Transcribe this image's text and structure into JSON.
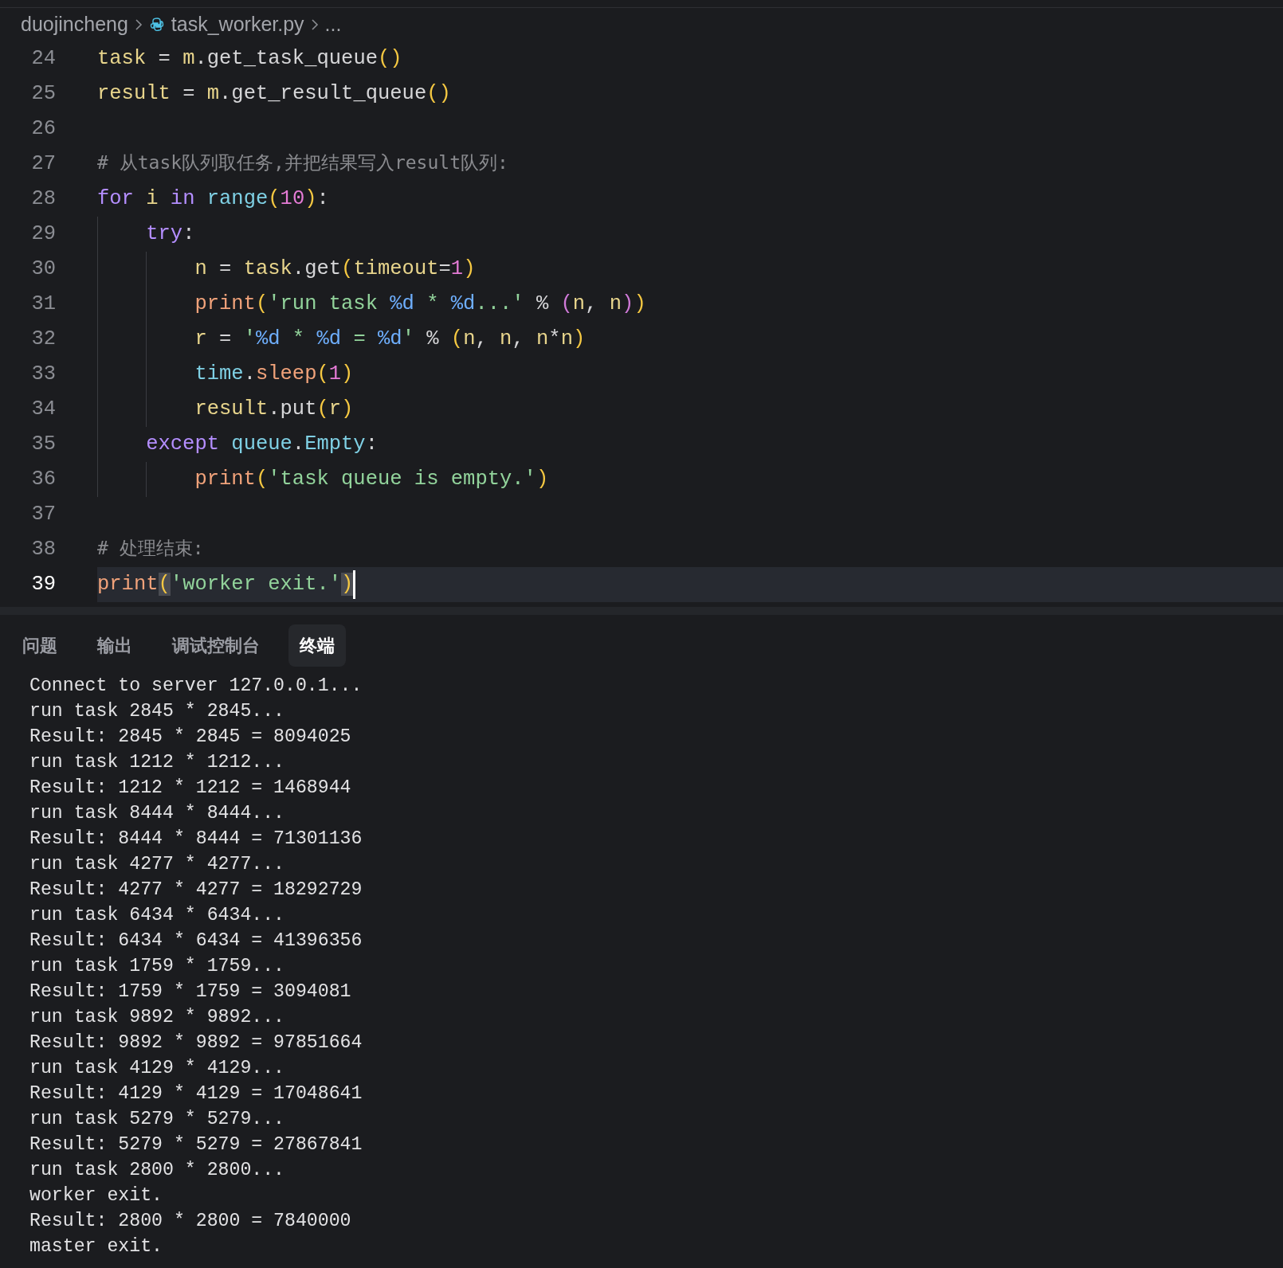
{
  "breadcrumb": [
    {
      "label": "duojincheng",
      "kind": "folder"
    },
    {
      "label": "task_worker.py",
      "kind": "file"
    },
    {
      "label": "...",
      "kind": "more"
    }
  ],
  "editor": {
    "lines": [
      {
        "number": "24",
        "current": false,
        "tokens": [
          {
            "kind": "var",
            "text": "task"
          },
          {
            "kind": "plain",
            "text": " = "
          },
          {
            "kind": "var",
            "text": "m"
          },
          {
            "kind": "plain",
            "text": ".get_task_queue"
          },
          {
            "kind": "paren",
            "text": "()"
          }
        ]
      },
      {
        "number": "25",
        "current": false,
        "tokens": [
          {
            "kind": "var",
            "text": "result"
          },
          {
            "kind": "plain",
            "text": " = "
          },
          {
            "kind": "var",
            "text": "m"
          },
          {
            "kind": "plain",
            "text": ".get_result_queue"
          },
          {
            "kind": "paren",
            "text": "()"
          }
        ]
      },
      {
        "number": "26",
        "current": false
      },
      {
        "number": "27",
        "current": false,
        "tokens": [
          {
            "kind": "comment",
            "text": "# 从task队列取任务,并把结果写入result队列:"
          }
        ]
      },
      {
        "number": "28",
        "current": false,
        "tokens": [
          {
            "kind": "keyword",
            "text": "for "
          },
          {
            "kind": "var",
            "text": "i "
          },
          {
            "kind": "keyword",
            "text": "in "
          },
          {
            "kind": "builtin",
            "text": "range"
          },
          {
            "kind": "paren",
            "text": "("
          },
          {
            "kind": "number",
            "text": "10"
          },
          {
            "kind": "paren",
            "text": ")"
          },
          {
            "kind": "plain",
            "text": ":"
          }
        ],
        "children": [
          {
            "number": "29",
            "current": false,
            "tokens": [
              {
                "kind": "keyword",
                "text": "try"
              },
              {
                "kind": "plain",
                "text": ":"
              }
            ],
            "children": [
              {
                "number": "30",
                "current": false,
                "tokens": [
                  {
                    "kind": "var",
                    "text": "n"
                  },
                  {
                    "kind": "plain",
                    "text": " = "
                  },
                  {
                    "kind": "var",
                    "text": "task"
                  },
                  {
                    "kind": "plain",
                    "text": ".get"
                  },
                  {
                    "kind": "paren",
                    "text": "("
                  },
                  {
                    "kind": "var",
                    "text": "timeout"
                  },
                  {
                    "kind": "plain",
                    "text": "="
                  },
                  {
                    "kind": "number",
                    "text": "1"
                  },
                  {
                    "kind": "paren",
                    "text": ")"
                  }
                ]
              },
              {
                "number": "31",
                "current": false,
                "tokens": [
                  {
                    "kind": "function",
                    "text": "print"
                  },
                  {
                    "kind": "paren",
                    "text": "("
                  },
                  {
                    "kind": "string",
                    "text": "'run task "
                  },
                  {
                    "kind": "format",
                    "text": "%d"
                  },
                  {
                    "kind": "string",
                    "text": " * "
                  },
                  {
                    "kind": "format",
                    "text": "%d"
                  },
                  {
                    "kind": "string",
                    "text": "...'"
                  },
                  {
                    "kind": "plain",
                    "text": " % "
                  },
                  {
                    "kind": "paren2",
                    "text": "("
                  },
                  {
                    "kind": "var",
                    "text": "n"
                  },
                  {
                    "kind": "plain",
                    "text": ", "
                  },
                  {
                    "kind": "var",
                    "text": "n"
                  },
                  {
                    "kind": "paren2",
                    "text": ")"
                  },
                  {
                    "kind": "paren",
                    "text": ")"
                  }
                ]
              },
              {
                "number": "32",
                "current": false,
                "tokens": [
                  {
                    "kind": "var",
                    "text": "r"
                  },
                  {
                    "kind": "plain",
                    "text": " = "
                  },
                  {
                    "kind": "string",
                    "text": "'"
                  },
                  {
                    "kind": "format",
                    "text": "%d"
                  },
                  {
                    "kind": "string",
                    "text": " * "
                  },
                  {
                    "kind": "format",
                    "text": "%d"
                  },
                  {
                    "kind": "string",
                    "text": " = "
                  },
                  {
                    "kind": "format",
                    "text": "%d"
                  },
                  {
                    "kind": "string",
                    "text": "'"
                  },
                  {
                    "kind": "plain",
                    "text": " % "
                  },
                  {
                    "kind": "paren",
                    "text": "("
                  },
                  {
                    "kind": "var",
                    "text": "n"
                  },
                  {
                    "kind": "plain",
                    "text": ", "
                  },
                  {
                    "kind": "var",
                    "text": "n"
                  },
                  {
                    "kind": "plain",
                    "text": ", "
                  },
                  {
                    "kind": "var",
                    "text": "n"
                  },
                  {
                    "kind": "plain",
                    "text": "*"
                  },
                  {
                    "kind": "var",
                    "text": "n"
                  },
                  {
                    "kind": "paren",
                    "text": ")"
                  }
                ]
              },
              {
                "number": "33",
                "current": false,
                "tokens": [
                  {
                    "kind": "builtin",
                    "text": "time"
                  },
                  {
                    "kind": "plain",
                    "text": "."
                  },
                  {
                    "kind": "function",
                    "text": "sleep"
                  },
                  {
                    "kind": "paren",
                    "text": "("
                  },
                  {
                    "kind": "number",
                    "text": "1"
                  },
                  {
                    "kind": "paren",
                    "text": ")"
                  }
                ]
              },
              {
                "number": "34",
                "current": false,
                "tokens": [
                  {
                    "kind": "var",
                    "text": "result"
                  },
                  {
                    "kind": "plain",
                    "text": ".put"
                  },
                  {
                    "kind": "paren",
                    "text": "("
                  },
                  {
                    "kind": "var",
                    "text": "r"
                  },
                  {
                    "kind": "paren",
                    "text": ")"
                  }
                ]
              }
            ]
          },
          {
            "number": "35",
            "current": false,
            "tokens": [
              {
                "kind": "keyword",
                "text": "except "
              },
              {
                "kind": "builtin",
                "text": "queue"
              },
              {
                "kind": "plain",
                "text": "."
              },
              {
                "kind": "builtin",
                "text": "Empty"
              },
              {
                "kind": "plain",
                "text": ":"
              }
            ],
            "children": [
              {
                "number": "36",
                "current": false,
                "tokens": [
                  {
                    "kind": "function",
                    "text": "print"
                  },
                  {
                    "kind": "paren",
                    "text": "("
                  },
                  {
                    "kind": "string",
                    "text": "'task queue is empty.'"
                  },
                  {
                    "kind": "paren",
                    "text": ")"
                  }
                ]
              }
            ]
          }
        ]
      },
      {
        "number": "37",
        "current": false
      },
      {
        "number": "38",
        "current": false,
        "tokens": [
          {
            "kind": "comment",
            "text": "# 处理结束:"
          }
        ]
      },
      {
        "number": "39",
        "current": true,
        "tokens": [
          {
            "kind": "function",
            "text": "print"
          },
          {
            "kind": "match",
            "text": "("
          },
          {
            "kind": "string",
            "text": "'worker exit.'"
          },
          {
            "kind": "match",
            "text": ")"
          }
        ]
      }
    ]
  },
  "panel": {
    "tabs": [
      {
        "label": "问题",
        "selected": false
      },
      {
        "label": "输出",
        "selected": false
      },
      {
        "label": "调试控制台",
        "selected": false
      },
      {
        "label": "终端",
        "selected": true
      }
    ],
    "terminal": [
      "Connect to server 127.0.0.1...",
      "run task 2845 * 2845...",
      "Result: 2845 * 2845 = 8094025",
      "run task 1212 * 1212...",
      "Result: 1212 * 1212 = 1468944",
      "run task 8444 * 8444...",
      "Result: 8444 * 8444 = 71301136",
      "run task 4277 * 4277...",
      "Result: 4277 * 4277 = 18292729",
      "run task 6434 * 6434...",
      "Result: 6434 * 6434 = 41396356",
      "run task 1759 * 1759...",
      "Result: 1759 * 1759 = 3094081",
      "run task 9892 * 9892...",
      "Result: 9892 * 9892 = 97851664",
      "run task 4129 * 4129...",
      "Result: 4129 * 4129 = 17048641",
      "run task 5279 * 5279...",
      "Result: 5279 * 5279 = 27867841",
      "run task 2800 * 2800...",
      "worker exit.",
      "Result: 2800 * 2800 = 7840000",
      "master exit."
    ]
  }
}
